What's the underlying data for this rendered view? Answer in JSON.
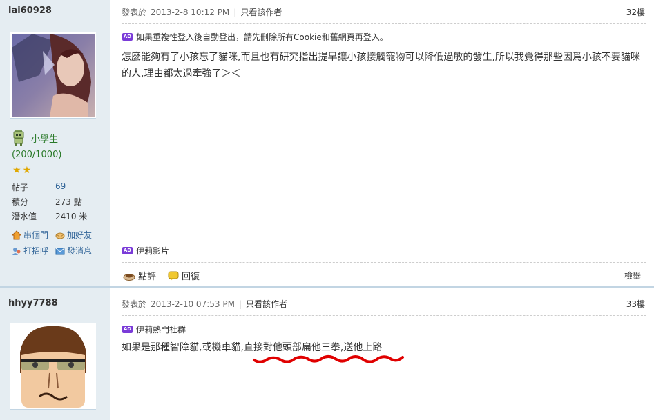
{
  "posts": [
    {
      "username": "lai60928",
      "rank_name": "小學生",
      "rank_points": "(200/1000)",
      "stats": [
        {
          "label": "帖子",
          "value": "69"
        },
        {
          "label": "積分",
          "value": "273 點"
        },
        {
          "label": "潛水值",
          "value": "2410 米"
        }
      ],
      "actions": [
        "串個門",
        "加好友",
        "打招呼",
        "發消息"
      ],
      "posted_label": "發表於",
      "posted_time": "2013-2-8 10:12 PM",
      "author_only": "只看該作者",
      "floor": "32樓",
      "ad_badge": "AD",
      "ad_text": "如果重複性登入後自動登出，請先刪除所有Cookie和舊網頁再登入。",
      "body": "怎麼能夠有了小孩忘了貓咪,而且也有研究指出提早讓小孩接觸寵物可以降低過敏的發生,所以我覺得那些因爲小孩不要貓咪的人,理由都太過牽強了＞＜",
      "sig_ad_text": "伊莉影片",
      "rate_label": "點評",
      "reply_label": "回復",
      "report_label": "檢舉"
    },
    {
      "username": "hhyy7788",
      "posted_label": "發表於",
      "posted_time": "2013-2-10 07:53 PM",
      "author_only": "只看該作者",
      "floor": "33樓",
      "ad_badge": "AD",
      "ad_text": "伊莉熱門社群",
      "body": "如果是那種智障貓,或機車貓,直接對他頭部扁他三拳,送他上路"
    }
  ],
  "colors": {
    "sidebar_bg": "#e5edf2",
    "link": "#336699",
    "rank": "#2a7a2a",
    "underline_marker": "#e00000"
  }
}
